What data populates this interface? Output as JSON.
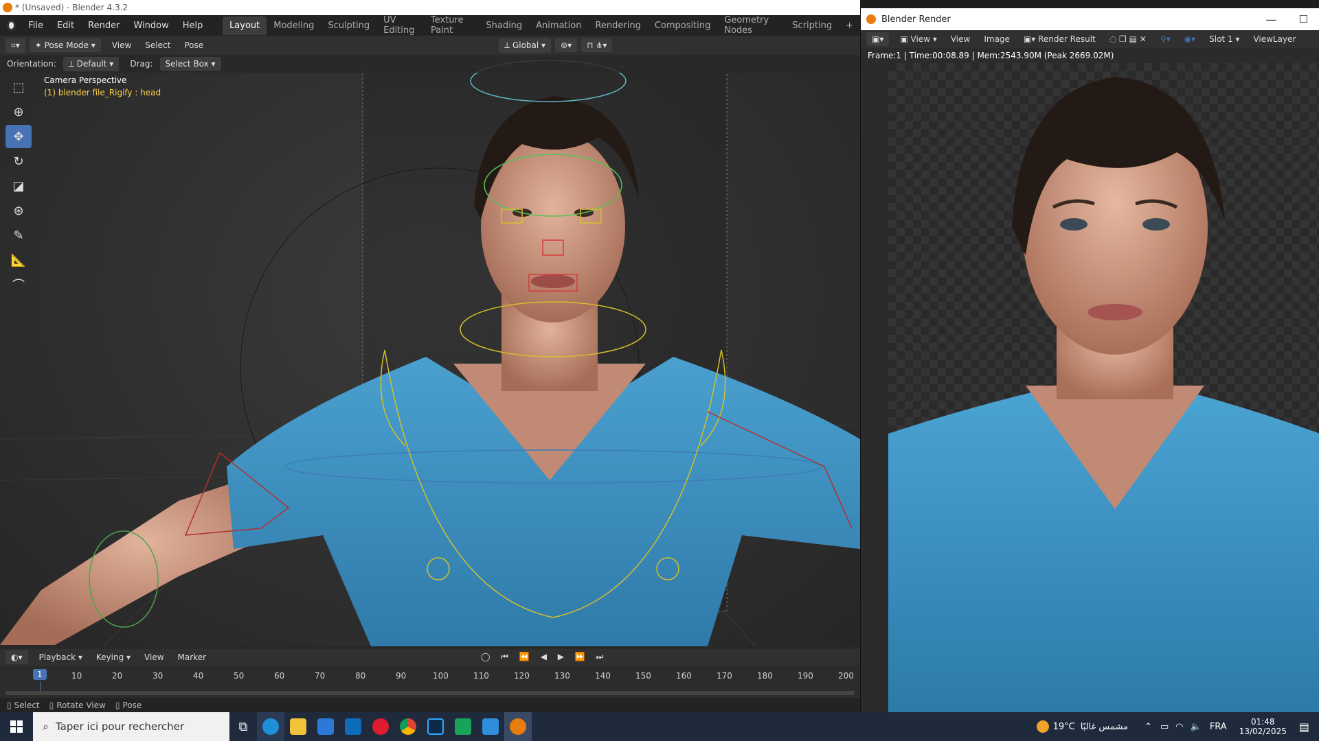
{
  "window_title": "* (Unsaved) - Blender 4.3.2",
  "menu": [
    "File",
    "Edit",
    "Render",
    "Window",
    "Help"
  ],
  "workspaces": [
    "Layout",
    "Modeling",
    "Sculpting",
    "UV Editing",
    "Texture Paint",
    "Shading",
    "Animation",
    "Rendering",
    "Compositing",
    "Geometry Nodes",
    "Scripting",
    "+"
  ],
  "header": {
    "mode": "Pose Mode",
    "view": "View",
    "select": "Select",
    "pose": "Pose",
    "transform": "Global"
  },
  "toolheader": {
    "orientation_label": "Orientation:",
    "orientation_value": "Default",
    "drag_label": "Drag:",
    "drag_value": "Select Box"
  },
  "viewport_info": {
    "perspective": "Camera Perspective",
    "object": "(1) blender file_Rigify : head"
  },
  "timeline": {
    "menus": [
      "Playback",
      "Keying",
      "View",
      "Marker"
    ],
    "current_frame": "1",
    "frames": [
      "10",
      "20",
      "30",
      "40",
      "50",
      "60",
      "70",
      "80",
      "90",
      "100",
      "110",
      "120",
      "130",
      "140",
      "150",
      "160",
      "170",
      "180",
      "190",
      "200"
    ]
  },
  "statusbar": {
    "select": "Select",
    "rotate": "Rotate View",
    "pose": "Pose"
  },
  "render_window": {
    "title": "Blender Render",
    "view": "View",
    "view2": "View",
    "image": "Image",
    "result": "Render Result",
    "slot": "Slot 1",
    "layer": "ViewLayer",
    "info": "Frame:1 | Time:00:08.89 | Mem:2543.90M (Peak 2669.02M)"
  },
  "taskbar": {
    "search_placeholder": "Taper ici pour rechercher",
    "weather": "19°C",
    "weather_text": "مشمس غالبًا",
    "lang": "FRA",
    "time": "01:48",
    "date": "13/02/2025"
  },
  "colors": {
    "accent": "#4772b3",
    "shirt": "#3b8fc0",
    "skin": "#d6a089",
    "hair": "#241a15"
  }
}
